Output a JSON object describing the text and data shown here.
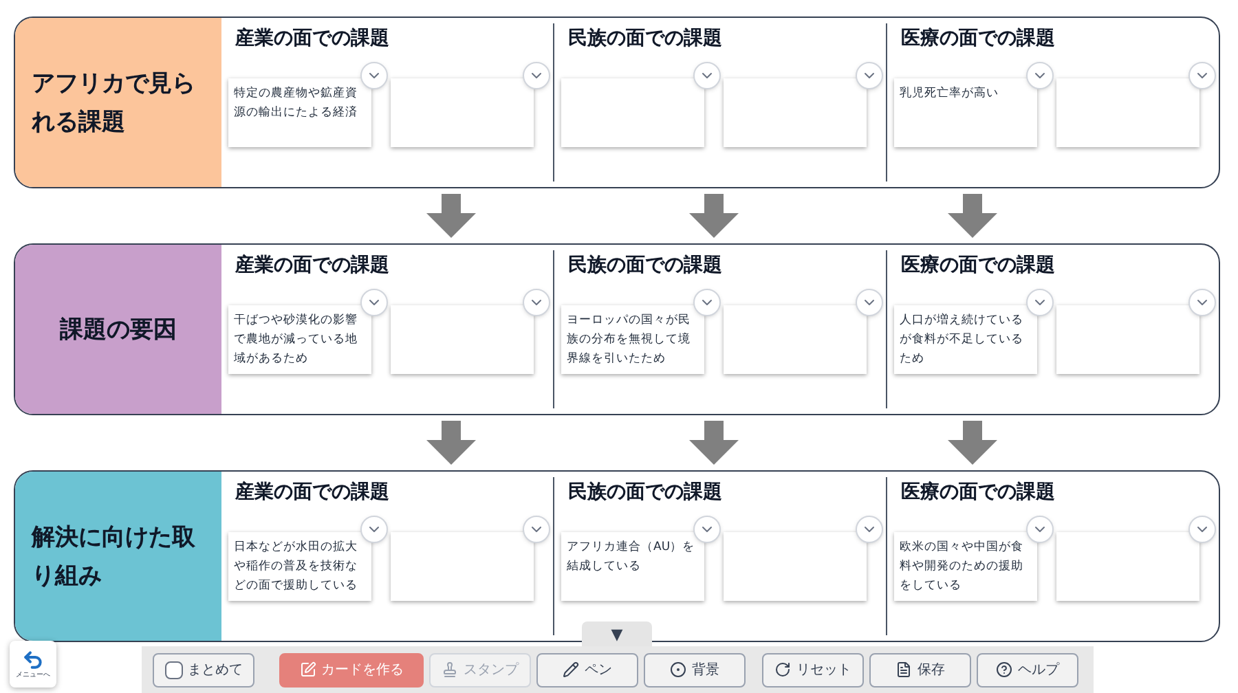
{
  "rows": [
    {
      "title": "アフリカで見られる課題",
      "color": "#fcc59b",
      "columns": [
        {
          "heading": "産業の面での課題",
          "cards": [
            {
              "kind": "note",
              "text": "特定の農産物や鉱産資源の輸出にたよる経済"
            },
            {
              "kind": "blank"
            }
          ]
        },
        {
          "heading": "民族の面での課題",
          "cards": [
            {
              "kind": "blank"
            },
            {
              "kind": "blank"
            }
          ]
        },
        {
          "heading": "医療の面での課題",
          "cards": [
            {
              "kind": "note",
              "text": "乳児死亡率が高い"
            },
            {
              "kind": "blank"
            }
          ]
        }
      ]
    },
    {
      "title": "課題の要因",
      "color": "#c89fcb",
      "columns": [
        {
          "heading": "産業の面での課題",
          "cards": [
            {
              "kind": "note",
              "text": "干ばつや砂漠化の影響で農地が減っている地域があるため"
            },
            {
              "kind": "blank"
            }
          ]
        },
        {
          "heading": "民族の面での課題",
          "cards": [
            {
              "kind": "note",
              "text": "ヨーロッパの国々が民族の分布を無視して境界線を引いたため"
            },
            {
              "kind": "blank"
            }
          ]
        },
        {
          "heading": "医療の面での課題",
          "cards": [
            {
              "kind": "note",
              "text": "人口が増え続けているが食料が不足しているため"
            },
            {
              "kind": "blank"
            }
          ]
        }
      ]
    },
    {
      "title": "解決に向けた取り組み",
      "color": "#6cc3d3",
      "columns": [
        {
          "heading": "産業の面での課題",
          "cards": [
            {
              "kind": "note",
              "text": "日本などが水田の拡大や稲作の普及を技術などの面で援助している"
            },
            {
              "kind": "blank"
            }
          ]
        },
        {
          "heading": "民族の面での課題",
          "cards": [
            {
              "kind": "note",
              "text": "アフリカ連合（AU）を結成している"
            },
            {
              "kind": "blank"
            }
          ]
        },
        {
          "heading": "医療の面での課題",
          "cards": [
            {
              "kind": "note",
              "text": "欧米の国々や中国が食料や開発のための援助をしている"
            },
            {
              "kind": "blank"
            }
          ]
        }
      ]
    }
  ],
  "toolbar": {
    "toggle": "▼",
    "buttons": [
      {
        "kind": "checkbox",
        "label": "まとめて",
        "checked": false,
        "active": false,
        "disabled": false
      },
      {
        "kind": "card",
        "label": "カードを作る",
        "active": true,
        "disabled": false
      },
      {
        "kind": "stamp",
        "label": "スタンプ",
        "active": false,
        "disabled": true
      },
      {
        "kind": "pen",
        "label": "ペン",
        "active": false,
        "disabled": false
      },
      {
        "kind": "background",
        "label": "背景",
        "active": false,
        "disabled": false
      },
      {
        "kind": "reset",
        "label": "リセット",
        "active": false,
        "disabled": false
      },
      {
        "kind": "save",
        "label": "保存",
        "active": false,
        "disabled": false
      },
      {
        "kind": "help",
        "label": "ヘルプ",
        "active": false,
        "disabled": false
      }
    ]
  },
  "menu_button": {
    "label": "メニューへ"
  }
}
